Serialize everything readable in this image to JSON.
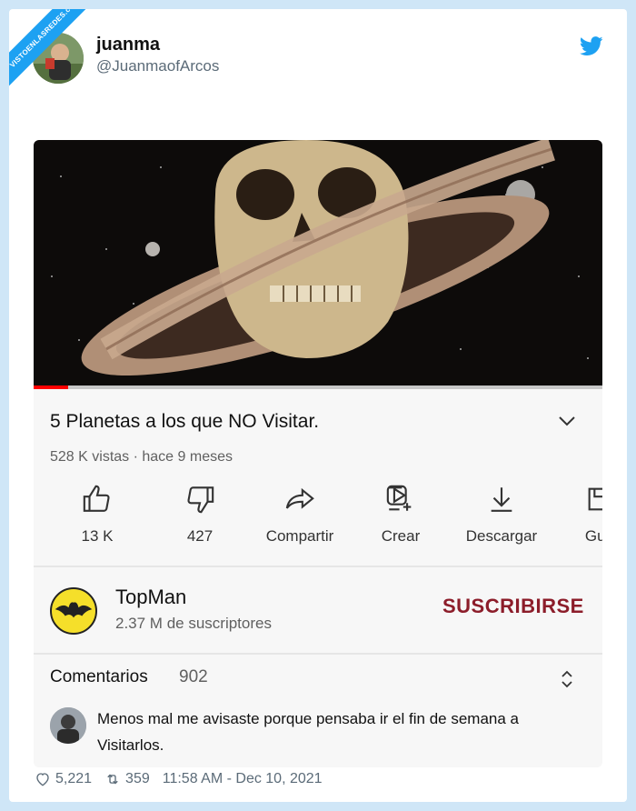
{
  "watermark": "VISTOENLASREDES.com",
  "tweet": {
    "user_name": "juanma",
    "handle": "@JuanmaofArcos",
    "likes": "5,221",
    "retweets": "359",
    "timestamp": "11:58 AM - Dec 10, 2021"
  },
  "video": {
    "title": "5 Planetas a los que NO Visitar.",
    "meta": "528 K vistas · hace 9 meses",
    "progress": 0.06,
    "actions": [
      {
        "label": "13 K",
        "icon": "thumbs-up-icon"
      },
      {
        "label": "427",
        "icon": "thumbs-down-icon"
      },
      {
        "label": "Compartir",
        "icon": "share-icon"
      },
      {
        "label": "Crear",
        "icon": "create-icon"
      },
      {
        "label": "Descargar",
        "icon": "download-icon"
      },
      {
        "label": "Gua",
        "icon": "save-icon"
      }
    ]
  },
  "channel": {
    "name": "TopMan",
    "subscribers": "2.37 M de suscriptores",
    "subscribe_label": "SUSCRIBIRSE"
  },
  "comments": {
    "label": "Comentarios",
    "count": "902",
    "first_comment": "Menos mal me avisaste porque  pensaba ir el fin de semana a Visitarlos."
  },
  "colors": {
    "background": "#cfe6f7",
    "twitter_blue": "#1da1f2",
    "subscribe": "#8c1d2a",
    "progress": "#ff0000"
  }
}
